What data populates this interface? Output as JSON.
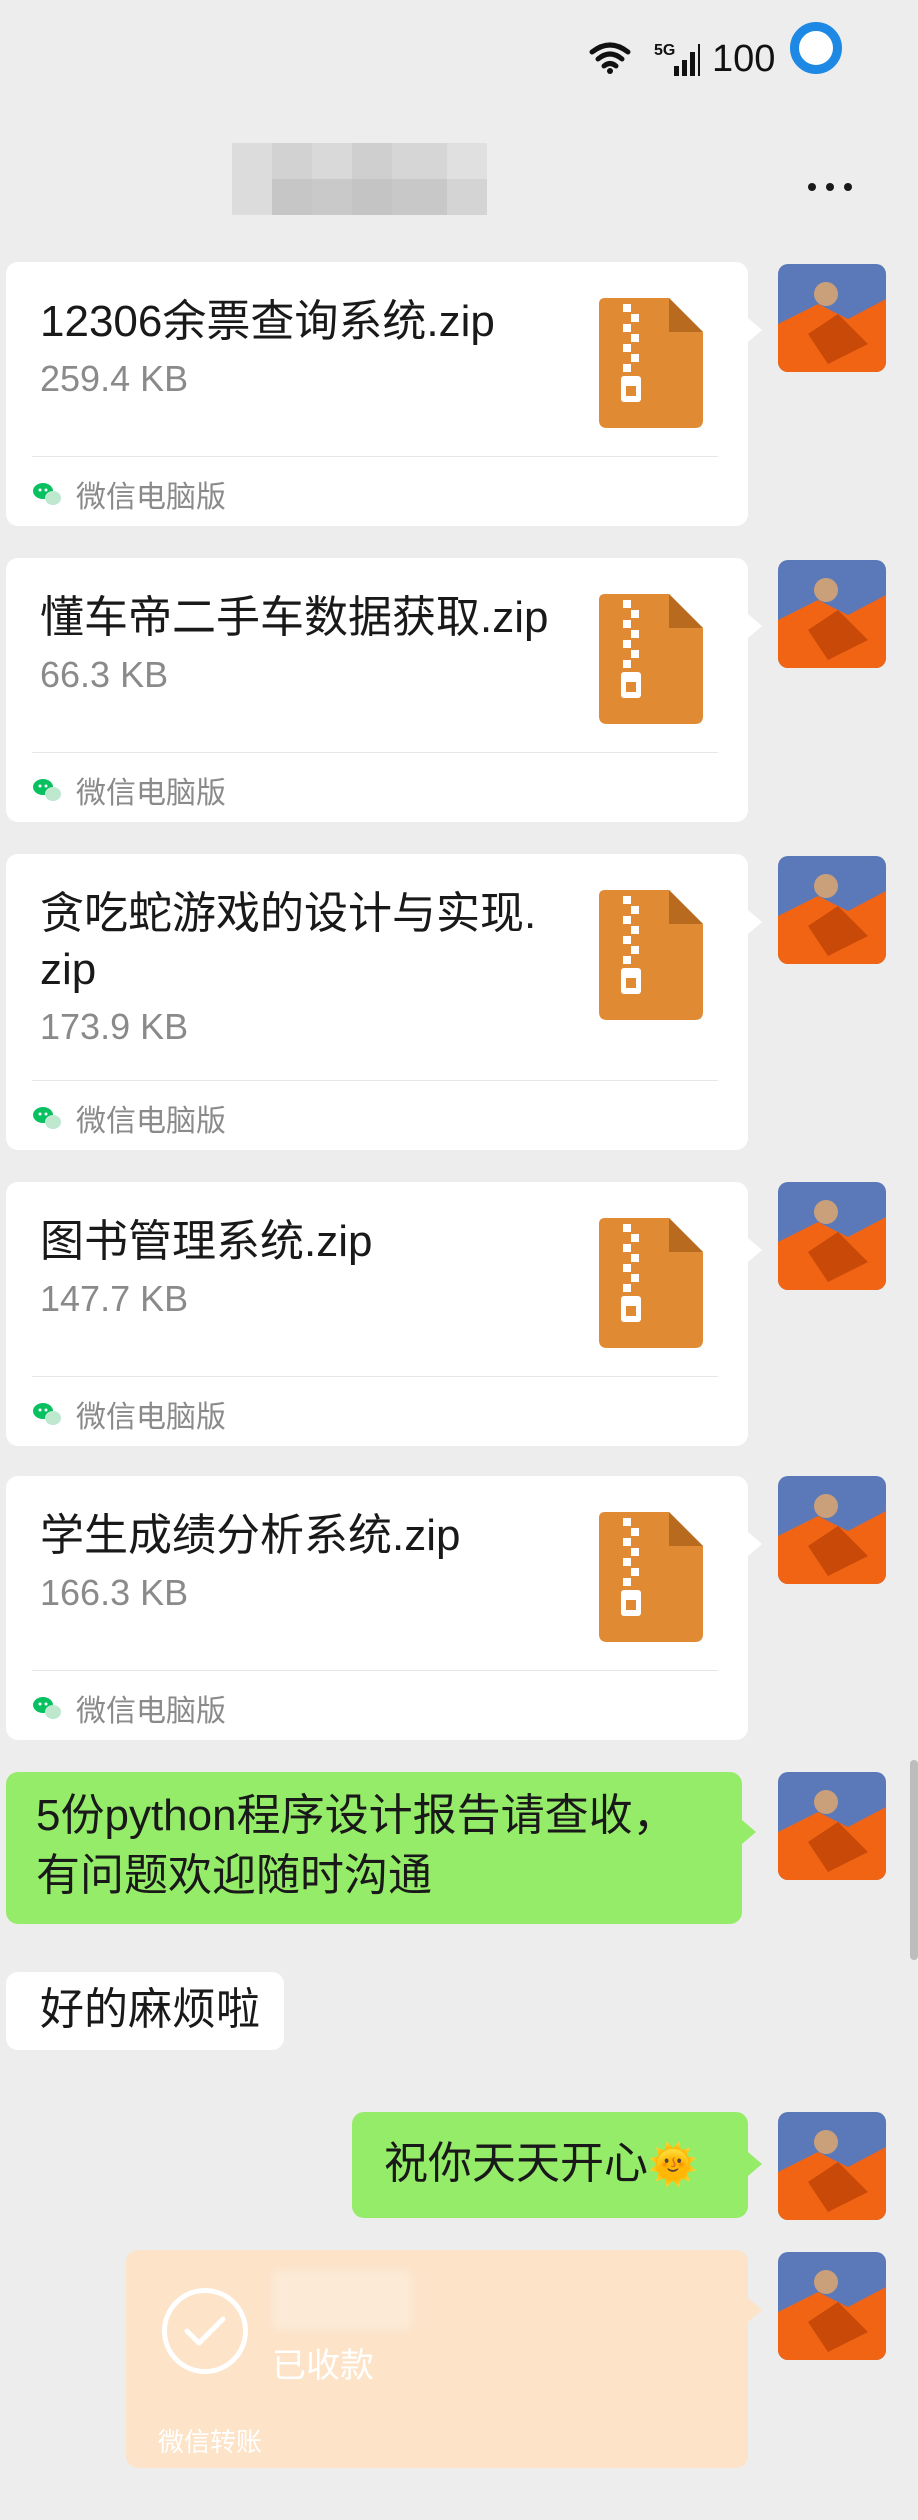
{
  "status_bar": {
    "network": "5G",
    "battery": "100"
  },
  "header": {
    "more_label": "..."
  },
  "files": [
    {
      "name": "12306余票查询系统.zip",
      "size": "259.4 KB",
      "source": "微信电脑版",
      "icon": "zip-file-icon"
    },
    {
      "name": "懂车帝二手车数据获取.zip",
      "size": "66.3 KB",
      "source": "微信电脑版",
      "icon": "zip-file-icon"
    },
    {
      "name": "贪吃蛇游戏的设计与实现.\nzip",
      "size": "173.9 KB",
      "source": "微信电脑版",
      "icon": "zip-file-icon"
    },
    {
      "name": "图书管理系统.zip",
      "size": "147.7 KB",
      "source": "微信电脑版",
      "icon": "zip-file-icon"
    },
    {
      "name": "学生成绩分析系统.zip",
      "size": "166.3 KB",
      "source": "微信电脑版",
      "icon": "zip-file-icon"
    }
  ],
  "messages": [
    {
      "side": "right",
      "text": "5份python程序设计报告请查收，有问题欢迎随时沟通"
    },
    {
      "side": "left",
      "text": "好的麻烦啦"
    },
    {
      "side": "right",
      "text": "祝你天天开心",
      "emoji": "🌞"
    }
  ],
  "transfer": {
    "status": "已收款",
    "footer": "微信转账"
  },
  "colors": {
    "background": "#ededed",
    "bubble_green": "#95ec69",
    "zip_orange": "#e08a33",
    "transfer_bg": "#fde3c8",
    "status_ring": "#1e88e5"
  }
}
